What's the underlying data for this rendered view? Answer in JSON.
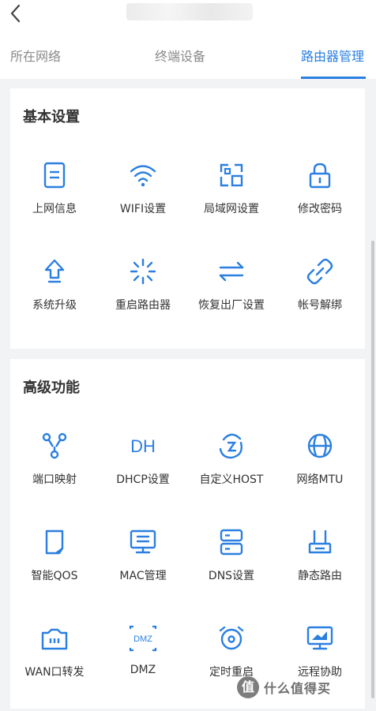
{
  "header": {
    "back_icon": "chevron-left-icon"
  },
  "tabs": [
    {
      "label": "所在网络",
      "active": false
    },
    {
      "label": "终端设备",
      "active": false
    },
    {
      "label": "路由器管理",
      "active": true
    }
  ],
  "accent_color": "#2a7fe0",
  "basic": {
    "title": "基本设置",
    "items": [
      {
        "label": "上网信息",
        "icon": "document-icon"
      },
      {
        "label": "WIFI设置",
        "icon": "wifi-icon"
      },
      {
        "label": "局域网设置",
        "icon": "lan-icon"
      },
      {
        "label": "修改密码",
        "icon": "lock-icon"
      },
      {
        "label": "系统升级",
        "icon": "upgrade-icon"
      },
      {
        "label": "重启路由器",
        "icon": "restart-icon"
      },
      {
        "label": "恢复出厂设置",
        "icon": "reset-icon"
      },
      {
        "label": "帐号解绑",
        "icon": "unlink-icon"
      }
    ]
  },
  "advanced": {
    "title": "高级功能",
    "items": [
      {
        "label": "端口映射",
        "icon": "port-mapping-icon"
      },
      {
        "label": "DHCP设置",
        "icon": "dhcp-icon",
        "icon_text": "DH"
      },
      {
        "label": "自定义HOST",
        "icon": "custom-host-icon"
      },
      {
        "label": "网络MTU",
        "icon": "mtu-icon"
      },
      {
        "label": "智能QOS",
        "icon": "qos-icon"
      },
      {
        "label": "MAC管理",
        "icon": "mac-icon"
      },
      {
        "label": "DNS设置",
        "icon": "dns-icon"
      },
      {
        "label": "静态路由",
        "icon": "static-route-icon"
      },
      {
        "label": "WAN口转发",
        "icon": "wan-forward-icon"
      },
      {
        "label": "DMZ",
        "icon": "dmz-icon",
        "icon_text": "DMZ"
      },
      {
        "label": "定时重启",
        "icon": "timer-restart-icon"
      },
      {
        "label": "远程协助",
        "icon": "remote-assist-icon"
      }
    ]
  },
  "watermark": {
    "mark": "值",
    "text": "什么值得买"
  }
}
